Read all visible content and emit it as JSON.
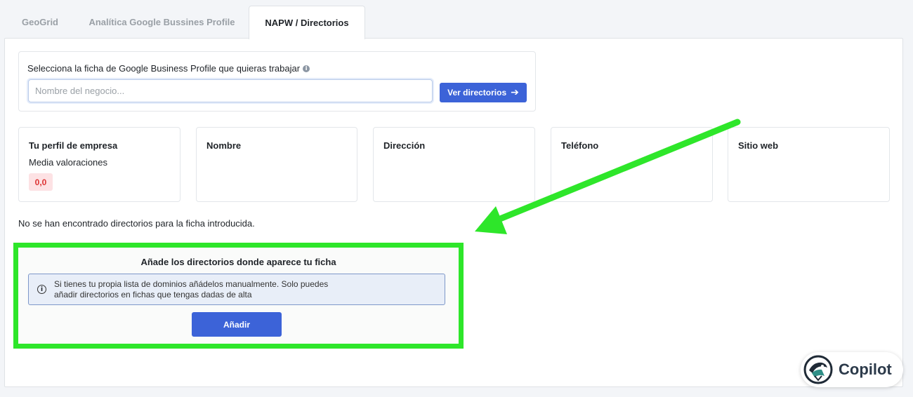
{
  "tabs": [
    {
      "label": "GeoGrid"
    },
    {
      "label": "Analítica Google Bussines Profile"
    },
    {
      "label": "NAPW / Directorios"
    }
  ],
  "active_tab": "NAPW / Directorios",
  "selector": {
    "label": "Selecciona la ficha de Google Business Profile que quieras trabajar",
    "info_icon": "i",
    "placeholder": "Nombre del negocio...",
    "button_label": "Ver directorios",
    "button_arrow": "➔"
  },
  "profile_cards": {
    "profile": {
      "title": "Tu perfil de empresa",
      "subtitle": "Media valoraciones",
      "rating": "0,0"
    },
    "name": {
      "title": "Nombre"
    },
    "address": {
      "title": "Dirección"
    },
    "phone": {
      "title": "Teléfono"
    },
    "website": {
      "title": "Sitio web"
    }
  },
  "no_directories_text": "No se han encontrado directorios para la ficha introducida.",
  "add_section": {
    "title": "Añade los directorios donde aparece tu ficha",
    "alert_icon": "i",
    "alert_text": "Si tienes tu propia lista de dominios añádelos manualmente. Solo puedes añadir directorios en fichas que tengas dadas de alta",
    "button_label": "Añadir"
  },
  "copilot": {
    "label": "Copilot"
  },
  "colors": {
    "primary": "#3c63d8",
    "highlight": "#2ee62a",
    "alert_bg": "#e8eef8",
    "rating_badge_bg": "#fde2e4",
    "rating_badge_text": "#dd3333"
  },
  "icons": {
    "info": "info-icon",
    "arrow_right": "arrow-right-icon",
    "copilot_logo": "copilot-logo-icon",
    "annotation_arrow": "green-arrow-annotation"
  }
}
